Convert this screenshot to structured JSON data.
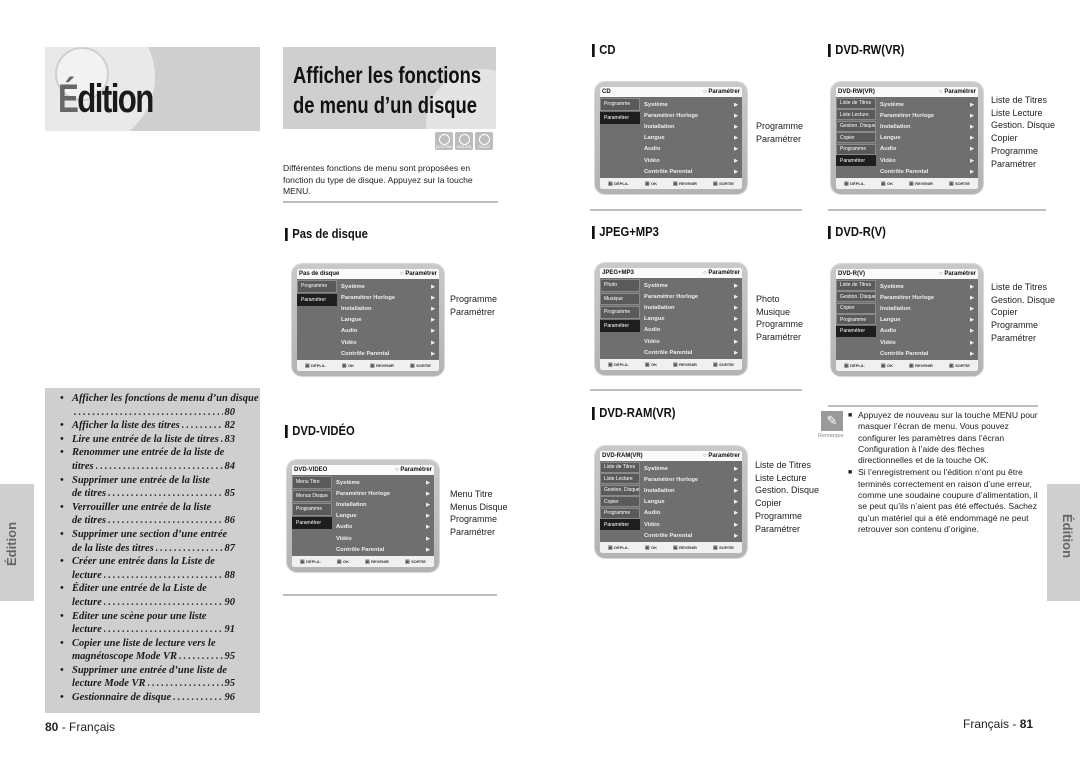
{
  "left_page": {
    "chapter_title_first": "É",
    "chapter_title_rest": "dition",
    "toc": [
      {
        "text": "Afficher les fonctions de menu d’un disque",
        "page": "80",
        "wrapped": true
      },
      {
        "text": "Afficher la liste des titres",
        "page": "82"
      },
      {
        "text": "Lire une entrée de la liste de titres",
        "page": "83"
      },
      {
        "text": "Renommer une entrée de la liste de",
        "text2": "titres",
        "page": "84"
      },
      {
        "text": "Supprimer une entrée de la liste",
        "text2": "de titres",
        "page": "85"
      },
      {
        "text": "Verrouiller une entrée de la liste",
        "text2": "de titres",
        "page": "86"
      },
      {
        "text": "Supprimer une section d’une entrée",
        "text2": "de la liste des titres",
        "page": "87"
      },
      {
        "text": "Créer une entrée dans la Liste de",
        "text2": "lecture",
        "page": "88"
      },
      {
        "text": "Éditer une entrée de la Liste de",
        "text2": "lecture",
        "page": "90"
      },
      {
        "text": "Editer une scène pour une liste",
        "text2": "lecture",
        "page": "91"
      },
      {
        "text": "Copier une liste de lecture vers le",
        "text2": "magnétoscope Mode VR",
        "page": "95"
      },
      {
        "text": "Supprimer une entrée d’une liste de",
        "text2": "lecture Mode VR",
        "page": "95"
      },
      {
        "text": "Gestionnaire de disque",
        "page": "96"
      }
    ],
    "side_tab": "Édition",
    "footer_page": "80",
    "footer_lang": " - Français"
  },
  "section": {
    "title_line1": "Afficher les fonctions",
    "title_line2": "de menu d’un disque",
    "badges": [
      "DVD-RAM",
      "DVD-RW",
      "DVD-R"
    ],
    "intro": "Différentes fonctions de menu sont proposées en fonction du type de disque. Appuyez sur la touche MENU."
  },
  "screens": {
    "common": {
      "setup_label": "Paramétrer",
      "menu": [
        "Système",
        "Paramétrer Horloge",
        "Installation",
        "Langue",
        "Audio",
        "Vidéo",
        "Contrôle Parental"
      ],
      "footer": [
        "DÉPLA.",
        "OK",
        "REVENIR",
        "SORTIE"
      ]
    },
    "no_disc": {
      "heading": "Pas de disque",
      "title": "Pas de disque",
      "side": [
        "Programme",
        "Paramétrer"
      ],
      "options": [
        "Programme",
        "Paramétrer"
      ]
    },
    "dvd_video": {
      "heading": "DVD-VIDÉO",
      "title": "DVD-VIDEO",
      "side": [
        "Menu Titre",
        "Menus Disque",
        "Programme",
        "Paramétrer"
      ],
      "options": [
        "Menu Titre",
        "Menus Disque",
        "Programme",
        "Paramétrer"
      ]
    },
    "cd": {
      "heading": "CD",
      "title": "CD",
      "side": [
        "Programme",
        "Paramétrer"
      ],
      "options": [
        "Programme",
        "Paramétrer"
      ]
    },
    "jpeg_mp3": {
      "heading": "JPEG+MP3",
      "title": "JPEG+MP3",
      "side": [
        "Photo",
        "Musique",
        "Programme",
        "Paramétrer"
      ],
      "options": [
        "Photo",
        "Musique",
        "Programme",
        "Paramétrer"
      ]
    },
    "dvd_ram_vr": {
      "heading": "DVD-RAM(VR)",
      "title": "DVD-RAM(VR)",
      "side": [
        "Liste de Titres",
        "Liste Lecture",
        "Gestion. Disque",
        "Copier",
        "Programme",
        "Paramétrer"
      ],
      "options": [
        "Liste de Titres",
        "Liste Lecture",
        "Gestion. Disque",
        "Copier",
        "Programme",
        "Paramétrer"
      ]
    },
    "dvd_rw_vr": {
      "heading": "DVD-RW(VR)",
      "title": "DVD-RW(VR)",
      "side": [
        "Liste de Titres",
        "Liste Lecture",
        "Gestion. Disque",
        "Copier",
        "Programme",
        "Paramétrer"
      ],
      "options": [
        "Liste de Titres",
        "Liste Lecture",
        "Gestion. Disque",
        "Copier",
        "Programme",
        "Paramétrer"
      ]
    },
    "dvd_r_v": {
      "heading": "DVD-R(V)",
      "title": "DVD-R(V)",
      "side": [
        "Liste de Titres",
        "Gestion. Disque",
        "Copier",
        "Programme",
        "Paramétrer"
      ],
      "options": [
        "Liste de Titres",
        "Gestion. Disque",
        "Copier",
        "Programme",
        "Paramétrer"
      ]
    }
  },
  "note": {
    "icon": "pencil-icon",
    "label": "Remarque",
    "items": [
      "Appuyez de nouveau sur la touche MENU pour masquer l’écran de menu. Vous pouvez configurer les paramètres dans l’écran Configuration à l’aide des flèches directionnelles et de la touche OK.",
      "Si l’enregistrement ou l’édition n’ont pu être terminés correctement en raison d’une erreur, comme une soudaine coupure d’alimentation, il se peut qu’ils n’aient pas été effectués. Sachez qu’un matériel qui a été endommagé ne peut retrouver son contenu d’origine."
    ]
  },
  "right_page": {
    "side_tab": "Édition",
    "footer_lang": "Français - ",
    "footer_page": "81"
  }
}
